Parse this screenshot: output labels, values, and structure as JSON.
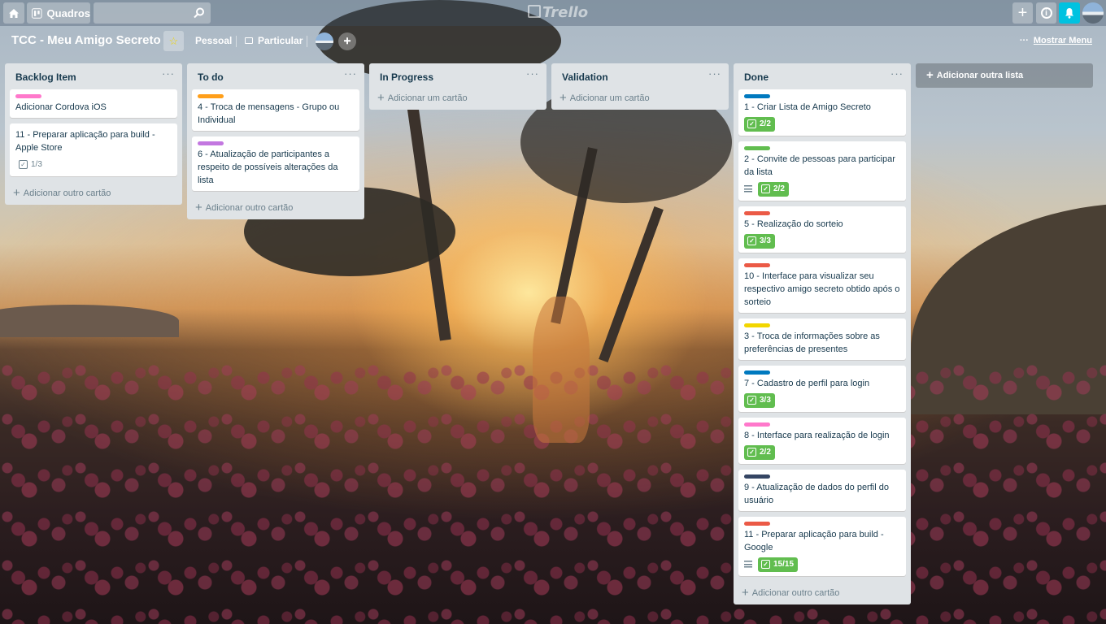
{
  "header": {
    "home_icon": "home-icon",
    "boards_label": "Quadros",
    "search_placeholder": "",
    "logo_text": "Trello",
    "add_icon": "plus-icon",
    "info_icon": "info-icon",
    "notification_icon": "bell-icon"
  },
  "board": {
    "title": "TCC - Meu Amigo Secreto",
    "team": "Pessoal",
    "visibility": "Particular",
    "show_menu": "Mostrar Menu"
  },
  "lists": [
    {
      "title": "Backlog Item",
      "cards": [
        {
          "label_color": "#ff78cb",
          "text": "Adicionar Cordova iOS"
        },
        {
          "label_color": null,
          "text": "11 - Preparar aplicação para build - Apple Store",
          "checklist": "1/3",
          "checklist_complete": false
        }
      ],
      "add_label": "Adicionar outro cartão"
    },
    {
      "title": "To do",
      "cards": [
        {
          "label_color": "#ff9f1a",
          "text": "4 - Troca de mensagens - Grupo ou Individual"
        },
        {
          "label_color": "#c377e0",
          "text": "6 - Atualização de participantes a respeito de possíveis alterações da lista"
        }
      ],
      "add_label": "Adicionar outro cartão"
    },
    {
      "title": "In Progress",
      "cards": [],
      "add_label": "Adicionar um cartão"
    },
    {
      "title": "Validation",
      "cards": [],
      "add_label": "Adicionar um cartão"
    },
    {
      "title": "Done",
      "cards": [
        {
          "label_color": "#0079bf",
          "text": "1 - Criar Lista de Amigo Secreto",
          "checklist": "2/2",
          "checklist_complete": true
        },
        {
          "label_color": "#61bd4f",
          "text": "2 - Convite de pessoas para participar da lista",
          "has_description": true,
          "checklist": "2/2",
          "checklist_complete": true
        },
        {
          "label_color": "#eb5a46",
          "text": "5 - Realização do sorteio",
          "checklist": "3/3",
          "checklist_complete": true
        },
        {
          "label_color": "#eb5a46",
          "text": "10 - Interface para visualizar seu respectivo amigo secreto obtido após o sorteio"
        },
        {
          "label_color": "#f2d600",
          "text": "3 - Troca de informações sobre as preferências de presentes"
        },
        {
          "label_color": "#0079bf",
          "text": "7 - Cadastro de perfil para login",
          "checklist": "3/3",
          "checklist_complete": true
        },
        {
          "label_color": "#ff78cb",
          "text": "8 - Interface para realização de login",
          "checklist": "2/2",
          "checklist_complete": true
        },
        {
          "label_color": "#344563",
          "text": "9 - Atualização de dados do perfil do usuário"
        },
        {
          "label_color": "#eb5a46",
          "text": "11 - Preparar aplicação para build - Google",
          "has_description": true,
          "checklist": "15/15",
          "checklist_complete": true
        }
      ],
      "add_label": "Adicionar outro cartão"
    }
  ],
  "add_list_label": "Adicionar outra lista"
}
